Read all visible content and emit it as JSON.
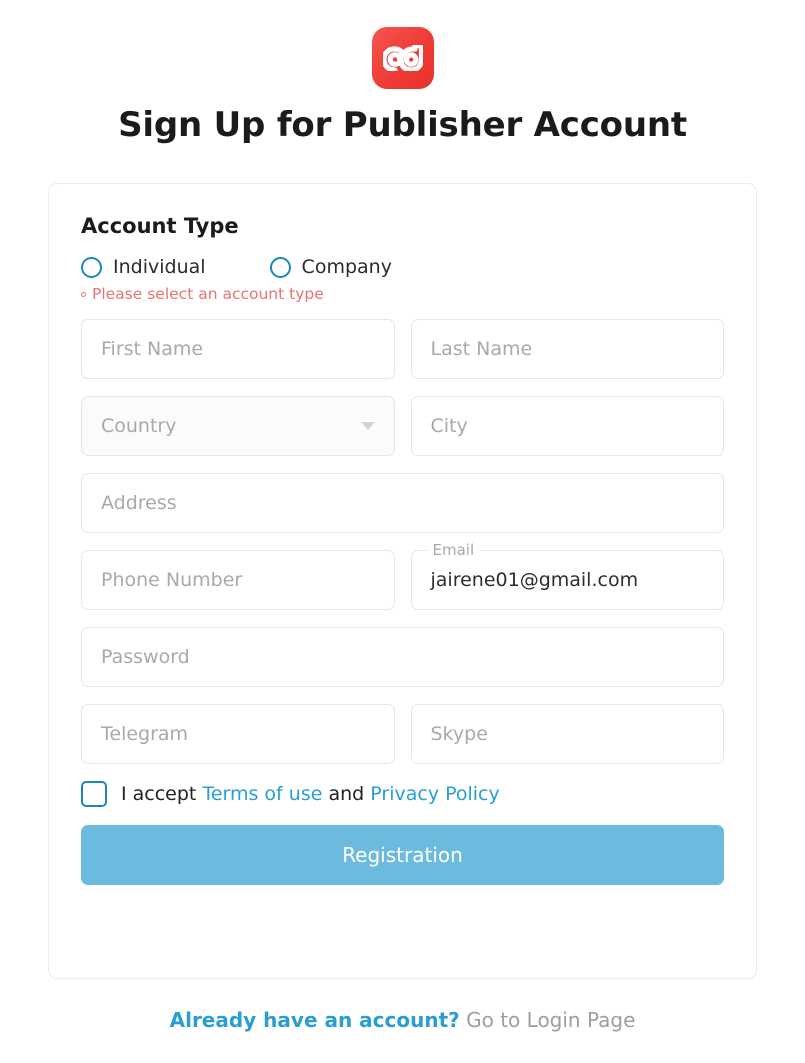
{
  "brand": {
    "logo_icon": "ad-monogram-logo",
    "logo_color": "#ef3b36"
  },
  "header": {
    "title": "Sign Up for Publisher Account"
  },
  "form": {
    "section_title": "Account Type",
    "account_type": {
      "options": [
        {
          "label": "Individual",
          "value": "individual",
          "selected": false
        },
        {
          "label": "Company",
          "value": "company",
          "selected": false
        }
      ],
      "error": "Please select an account type",
      "error_color": "#e8736f"
    },
    "fields": {
      "first_name": {
        "placeholder": "First Name",
        "value": ""
      },
      "last_name": {
        "placeholder": "Last Name",
        "value": ""
      },
      "country": {
        "placeholder": "Country",
        "value": "",
        "icon": "chevron-down-icon"
      },
      "city": {
        "placeholder": "City",
        "value": ""
      },
      "address": {
        "placeholder": "Address",
        "value": ""
      },
      "phone": {
        "placeholder": "Phone Number",
        "value": ""
      },
      "email": {
        "label": "Email",
        "placeholder": "Email",
        "value": "jairene01@gmail.com"
      },
      "password": {
        "placeholder": "Password",
        "value": ""
      },
      "telegram": {
        "placeholder": "Telegram",
        "value": ""
      },
      "skype": {
        "placeholder": "Skype",
        "value": ""
      }
    },
    "terms": {
      "accept_text": "I accept",
      "terms_link": "Terms of use",
      "and_text": "and",
      "privacy_link": "Privacy Policy",
      "checked": false,
      "link_color": "#2a9ed0"
    },
    "submit": {
      "label": "Registration",
      "color": "#6cbbdf"
    }
  },
  "footer": {
    "prompt": "Already have an account?",
    "link": "Go to Login Page"
  }
}
